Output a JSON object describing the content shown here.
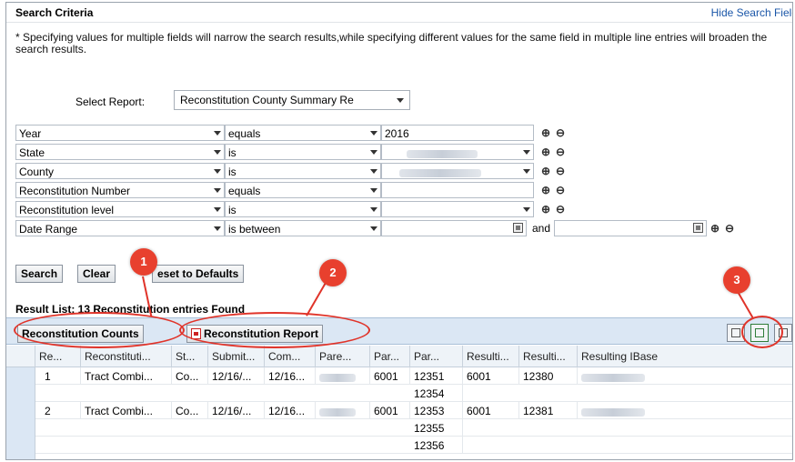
{
  "panel": {
    "title": "Search Criteria",
    "hide_link": "Hide Search Fields",
    "info_text": "* Specifying values for multiple fields will narrow the search results,while specifying different values for the same field in multiple line entries will broaden the search results."
  },
  "select_report": {
    "label": "Select Report:",
    "value": "Reconstitution County Summary Re"
  },
  "criteria": [
    {
      "field": "Year",
      "operator": "equals",
      "value": "2016"
    },
    {
      "field": "State",
      "operator": "is",
      "value": ""
    },
    {
      "field": "County",
      "operator": "is",
      "value": ""
    },
    {
      "field": "Reconstitution Number",
      "operator": "equals",
      "value": ""
    },
    {
      "field": "Reconstitution level",
      "operator": "is",
      "value": ""
    },
    {
      "field": "Date Range",
      "operator": "is between",
      "value": "",
      "and_label": "and",
      "value2": ""
    }
  ],
  "buttons": {
    "search": "Search",
    "clear": "Clear",
    "reset": "eset to Defaults"
  },
  "result": {
    "title": "Result List: 13 Reconstitution entries Found"
  },
  "toolbar": {
    "counts": "Reconstitution Counts",
    "report": "Reconstitution Report"
  },
  "table": {
    "headers": [
      "Re...",
      "Reconstituti...",
      "St...",
      "Submit...",
      "Com...",
      "Pare...",
      "Par...",
      "Par...",
      "Resulti...",
      "Resulti...",
      "Resulting IBase"
    ],
    "rows": [
      [
        "1",
        "Tract Combi...",
        "Co...",
        "12/16/...",
        "12/16...",
        "",
        "6001",
        "12351",
        "6001",
        "12380",
        ""
      ],
      [
        "",
        "",
        "",
        "",
        "",
        "",
        "",
        "12354",
        "",
        "",
        ""
      ],
      [
        "2",
        "Tract Combi...",
        "Co...",
        "12/16/...",
        "12/16...",
        "",
        "6001",
        "12353",
        "6001",
        "12381",
        ""
      ],
      [
        "",
        "",
        "",
        "",
        "",
        "",
        "",
        "12355",
        "",
        "",
        ""
      ],
      [
        "",
        "",
        "",
        "",
        "",
        "",
        "",
        "12356",
        "",
        "",
        ""
      ]
    ]
  },
  "callouts": [
    "1",
    "2",
    "3"
  ],
  "colors": {
    "callout": "#e8402e",
    "link": "#1a56a8",
    "toolbar_bg": "#dbe7f4"
  }
}
